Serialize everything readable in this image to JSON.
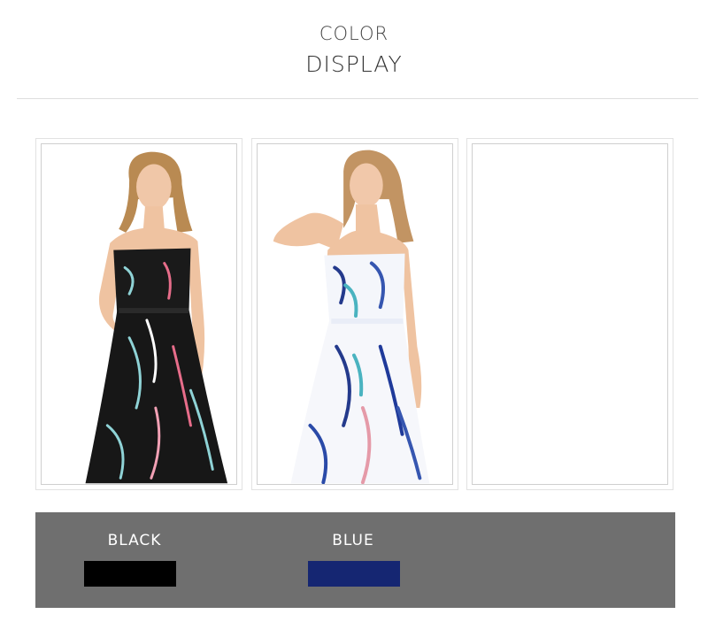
{
  "header": {
    "title_line1": "COLOR",
    "title_line2": "DISPLAY"
  },
  "gallery": {
    "items": [
      {
        "id": "black-dress",
        "alt": "Model in black floral strapless dress"
      },
      {
        "id": "blue-dress",
        "alt": "Model in white and blue floral strapless dress"
      },
      {
        "id": "empty",
        "alt": ""
      }
    ]
  },
  "swatches": [
    {
      "label": "BLACK",
      "color": "#000000"
    },
    {
      "label": "BLUE",
      "color": "#152672"
    }
  ],
  "colors": {
    "panel_bg": "#6f6f6f",
    "divider": "#dedede",
    "heading_text": "#444444"
  }
}
